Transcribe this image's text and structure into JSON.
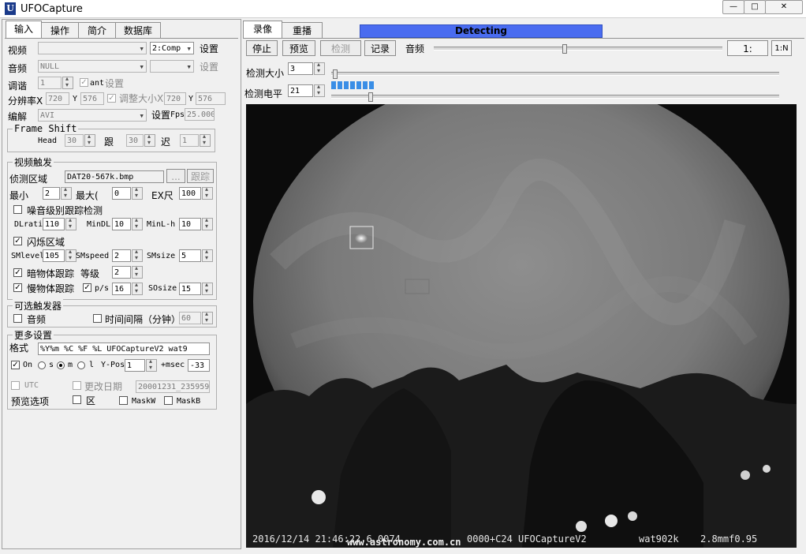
{
  "window": {
    "title": "UFOCapture",
    "app_icon_letter": "U",
    "btn_min": "—",
    "btn_max": "□",
    "btn_close": "✕"
  },
  "left_tabs": [
    "输入",
    "操作",
    "简介",
    "数据库"
  ],
  "input": {
    "video_label": "视频",
    "video_value": "",
    "video_mode": "2:Comp",
    "video_settings": "设置",
    "audio_label": "音频",
    "audio_value": "NULL",
    "audio_mode": "",
    "audio_settings": "设置",
    "tuning_label": "调谐",
    "tuning_value": "1",
    "ant_label": "ant",
    "tuning_settings": "设置",
    "res_label": "分辨率X",
    "res_x": "720",
    "res_y_label": "Y",
    "res_y": "576",
    "resize_label": "调整大小X",
    "resize_x": "720",
    "resize_y_label": "Y",
    "resize_y": "576",
    "codec_label": "编解",
    "codec_value": "AVI",
    "codec_settings": "设置",
    "fps_label": "Fps",
    "fps_value": "25.000",
    "frame_shift_title": "Frame Shift",
    "head_label": "Head",
    "head_value": "30",
    "track_label": "跟",
    "track_value": "30",
    "delay_label": "迟",
    "delay_value": "1"
  },
  "video_trigger": {
    "title": "视频触发",
    "area_label": "侦测区域",
    "area_file": "DAT20-567k.bmp",
    "browse": "...",
    "track_btn": "跟踪",
    "min_label": "最小",
    "min_value": "2",
    "max_label": "最大(",
    "max_value": "0",
    "ex_label": "EX尺",
    "ex_value": "100",
    "noise_label": "噪音级别跟踪检测",
    "dl_label": "DLrati",
    "dl_value": "110",
    "mindl_label": "MinDL",
    "mindl_value": "10",
    "minl_label": "MinL-h",
    "minl_value": "10",
    "flash_label": "闪烁区域",
    "smlevel_label": "SMlevel",
    "smlevel_value": "105",
    "smspeed_label": "SMspeed",
    "smspeed_value": "2",
    "smsize_label": "SMsize",
    "smsize_value": "5",
    "dark_label": "暗物体跟踪",
    "grade_label": "等级",
    "grade_value": "2",
    "slow_label": "慢物体跟踪",
    "ps_label": "p/s",
    "ps_value": "16",
    "sosize_label": "SOsize",
    "sosize_value": "15"
  },
  "optional_trigger": {
    "title": "可选触发器",
    "audio_label": "音频",
    "interval_label": "时间间隔（分钟）",
    "interval_value": "60"
  },
  "more_settings": {
    "title": "更多设置",
    "format_label": "格式",
    "format_value": "%Y%m %C %F %L UFOCaptureV2    wat9",
    "on_label": "On",
    "s_label": "s",
    "m_label": "m",
    "l_label": "l",
    "ypos_label": "Y-Pos",
    "ypos_value": "1",
    "msec_label": "+msec",
    "msec_value": "-33",
    "utc_label": "UTC",
    "change_date_label": "更改日期",
    "change_date_value": "20001231_235959",
    "preview_label": "预览选项",
    "zone_label": "区",
    "maskw_label": "MaskW",
    "maskb_label": "MaskB"
  },
  "right_tabs": [
    "录像",
    "重播"
  ],
  "status": "Detecting",
  "toolbar": {
    "stop": "停止",
    "preview": "预览",
    "detect": "检测",
    "record": "记录",
    "audio_label": "音频",
    "scale1": "1:",
    "scale2": "1:N"
  },
  "detect_size_label": "检测大小",
  "detect_size_value": "3",
  "detect_level_label": "检测电平",
  "detect_level_value": "21",
  "level_meter_fraction": 0.1,
  "video": {
    "timestamp": "2016/12/14 21:46:22.6 0074",
    "frame_info": "0000+C24 UFOCaptureV2",
    "camera": "wat902k",
    "lens": "2.8mmf0.95",
    "watermark": "www.astronomy.com.cn"
  }
}
